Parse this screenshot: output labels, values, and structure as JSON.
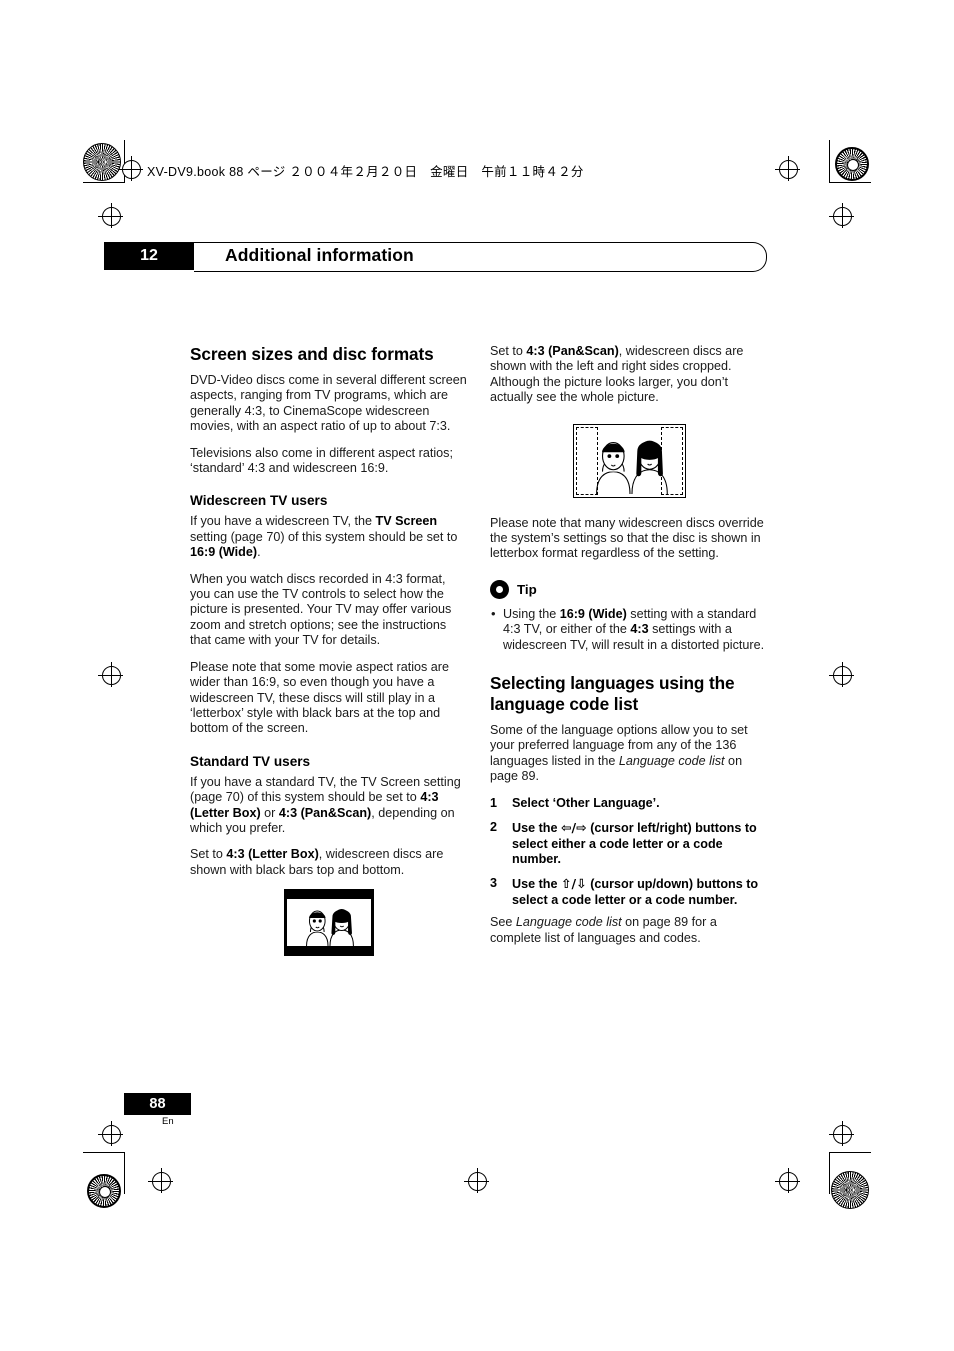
{
  "header": {
    "book_line": "XV-DV9.book  88 ページ  ２００４年２月２０日　金曜日　午前１１時４２分"
  },
  "chapter": {
    "number": "12",
    "title": "Additional information"
  },
  "left_column": {
    "heading": "Screen sizes and disc formats",
    "p1": "DVD-Video discs come in several different screen aspects, ranging from TV programs, which are generally 4:3, to CinemaScope widescreen movies, with an aspect ratio of up to about 7:3.",
    "p2": "Televisions also come in different aspect ratios; ‘standard’ 4:3 and widescreen 16:9.",
    "sub1": "Widescreen TV users",
    "p3_a": "If you have a widescreen TV, the ",
    "p3_b": "TV Screen",
    "p3_c": " setting (page 70) of this system should be set to ",
    "p3_d": "16:9 (Wide)",
    "p3_e": ".",
    "p4": "When you watch discs recorded in 4:3 format, you can use the TV controls to select how the picture is presented. Your TV may offer various zoom and stretch options; see the instructions that came with your TV for details.",
    "p5": "Please note that some movie aspect ratios are wider than 16:9, so even though you have a widescreen TV, these discs will still play in a ‘letterbox’ style with black bars at the top and bottom of the screen.",
    "sub2": "Standard TV users",
    "p6_a": "If you have a standard TV, the TV Screen setting (page 70) of this system should be set to ",
    "p6_b": "4:3 (Letter Box)",
    "p6_c": " or ",
    "p6_d": "4:3 (Pan&Scan)",
    "p6_e": ", depending on which you prefer.",
    "p7_a": "Set to ",
    "p7_b": "4:3 (Letter Box)",
    "p7_c": ", widescreen discs are shown with black bars top and bottom.",
    "figure_name": "letterbox-tv-illustration"
  },
  "right_column": {
    "p1_a": "Set to ",
    "p1_b": "4:3 (Pan&Scan)",
    "p1_c": ", widescreen discs are shown with the left and right sides cropped. Although the picture looks larger, you don’t actually see the whole picture.",
    "figure_name": "panscan-tv-illustration",
    "p2": "Please note that many widescreen discs override the system’s settings so that the disc is shown in letterbox format regardless of the setting.",
    "tip_label": "Tip",
    "tip_a": "Using the ",
    "tip_b": "16:9 (Wide)",
    "tip_c": " setting with a standard 4:3 TV, or either of the ",
    "tip_d": "4:3",
    "tip_e": " settings with a widescreen TV, will result in a distorted picture.",
    "heading2_line1": "Selecting languages using the",
    "heading2_line2": "language code list",
    "p3_a": "Some of the language options allow you to set your preferred language from any of the 136 languages listed in the ",
    "p3_b": "Language code list",
    "p3_c": " on page 89.",
    "steps": [
      {
        "num": "1",
        "text": "Select ‘Other Language’."
      },
      {
        "num": "2",
        "text_a": "Use the ",
        "glyph": "⇦/⇨",
        "text_b": " (cursor left/right) buttons to select either a code letter or a code number."
      },
      {
        "num": "3",
        "text_a": "Use the ",
        "glyph": "⇧/⇩",
        "text_b": " (cursor up/down) buttons to select a code letter or a code number."
      }
    ],
    "p4_a": "See ",
    "p4_b": "Language code list",
    "p4_c": " on page 89 for a complete list of languages and codes."
  },
  "footer": {
    "page_number": "88",
    "language_code": "En"
  }
}
